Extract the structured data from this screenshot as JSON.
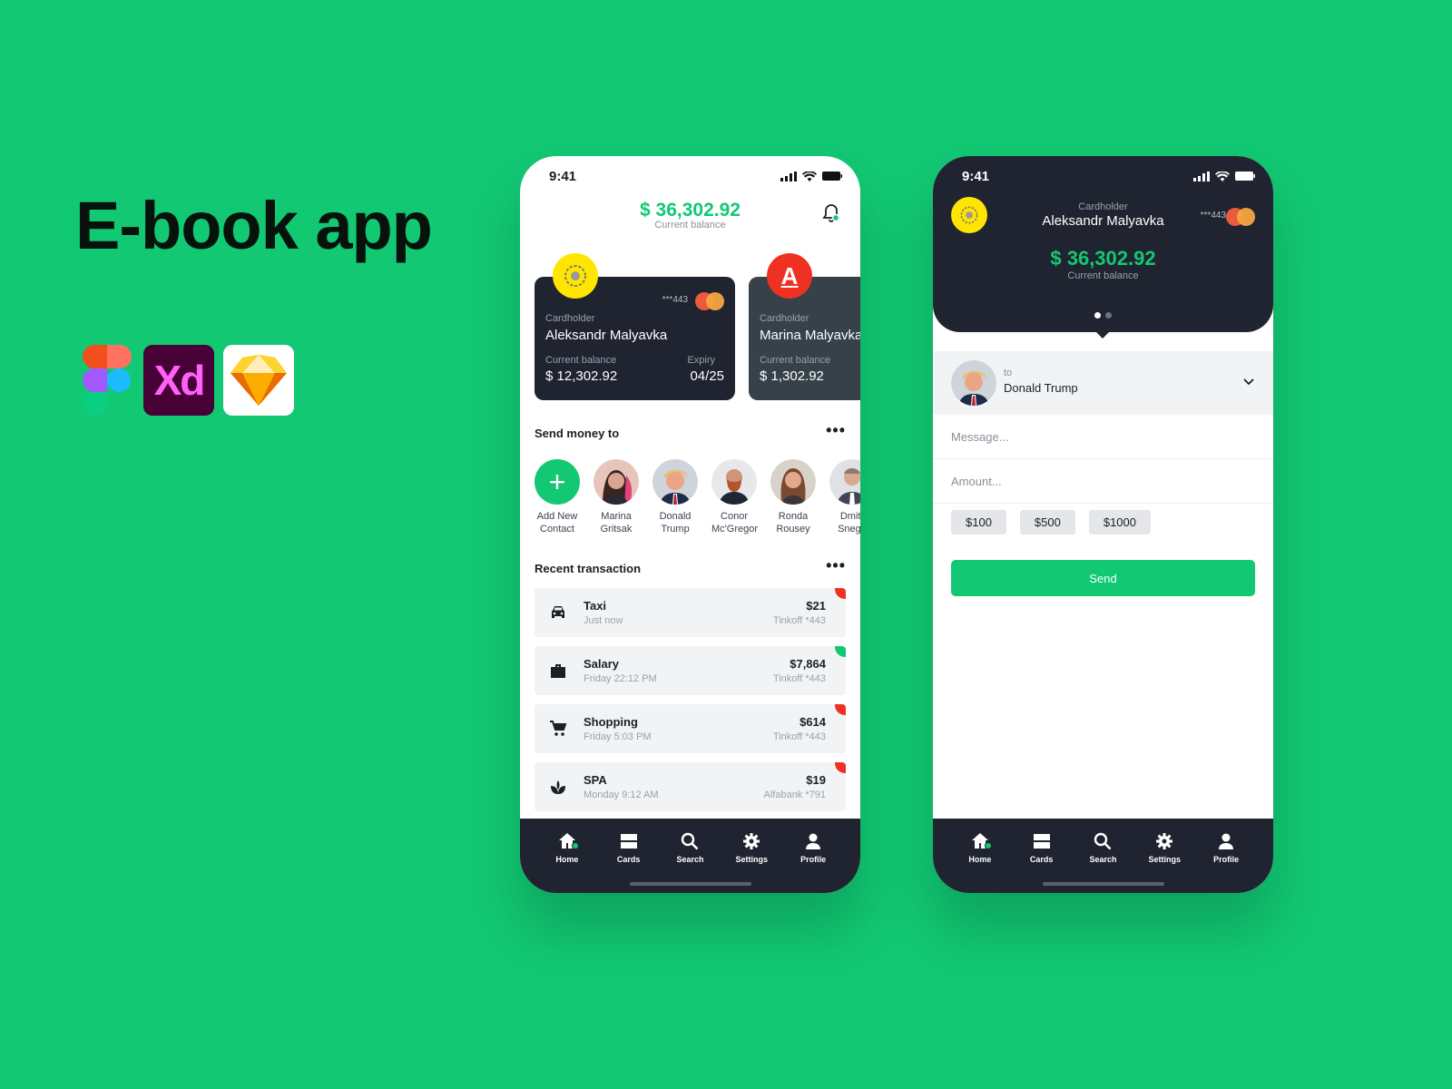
{
  "hero": {
    "title": "E-book app"
  },
  "tools": {
    "xd": "Xd"
  },
  "status": {
    "time": "9:41"
  },
  "balance": {
    "amount": "$ 36,302.92",
    "caption": "Current balance"
  },
  "cards": [
    {
      "badge": "",
      "mask": "***443",
      "holder_label": "Cardholder",
      "holder": "Aleksandr Malyavka",
      "balance_label": "Current balance",
      "balance": "$ 12,302.92",
      "expiry_label": "Expiry",
      "expiry": "04/25"
    },
    {
      "badge": "A",
      "holder_label": "Cardholder",
      "holder": "Marina Malyavka",
      "balance_label": "Current balance",
      "balance": "$ 1,302.92"
    }
  ],
  "send": {
    "title": "Send money to",
    "more": "•••",
    "contacts": [
      {
        "name": "Add New\nContact",
        "add_symbol": "+"
      },
      {
        "name": "Marina\nGritsak",
        "color": "#c98a7a"
      },
      {
        "name": "Donald\nTrump",
        "color": "#b88a6a"
      },
      {
        "name": "Conor\nMc'Gregor",
        "color": "#7d6a5c"
      },
      {
        "name": "Ronda\nRousey",
        "color": "#8c6e5a"
      },
      {
        "name": "Dmitr\nSnego",
        "color": "#9aa0a8"
      }
    ]
  },
  "recent": {
    "title": "Recent transaction",
    "more": "•••",
    "items": [
      {
        "icon": "car-icon",
        "name": "Taxi",
        "time": "Just now",
        "amount": "$21",
        "source": "Tinkoff *443",
        "flag": "#EF3124"
      },
      {
        "icon": "briefcase-icon",
        "name": "Salary",
        "time": "Friday 22:12 PM",
        "amount": "$7,864",
        "source": "Tinkoff *443",
        "flag": "#12C873"
      },
      {
        "icon": "cart-icon",
        "name": "Shopping",
        "time": "Friday 5:03 PM",
        "amount": "$614",
        "source": "Tinkoff *443",
        "flag": "#EF3124"
      },
      {
        "icon": "spa-icon",
        "name": "SPA",
        "time": "Monday 9:12 AM",
        "amount": "$19",
        "source": "Alfabank *791",
        "flag": "#EF3124"
      }
    ]
  },
  "tabs": [
    {
      "icon": "home-icon",
      "label": "Home",
      "active": true
    },
    {
      "icon": "cards-icon",
      "label": "Cards"
    },
    {
      "icon": "search-icon",
      "label": "Search"
    },
    {
      "icon": "gear-icon",
      "label": "Settings"
    },
    {
      "icon": "profile-icon",
      "label": "Profile"
    }
  ],
  "transfer": {
    "holder_label": "Cardholder",
    "holder": "Aleksandr Malyavka",
    "mask": "***443",
    "amount": "$ 36,302.92",
    "caption": "Current balance",
    "to_label": "to",
    "to_name": "Donald Trump",
    "message_placeholder": "Message...",
    "amount_placeholder": "Amount...",
    "chips": [
      "$100",
      "$500",
      "$1000"
    ],
    "send_label": "Send"
  },
  "colors": {
    "accent": "#12C873",
    "dark": "#1f2430",
    "alert": "#EF3124"
  }
}
